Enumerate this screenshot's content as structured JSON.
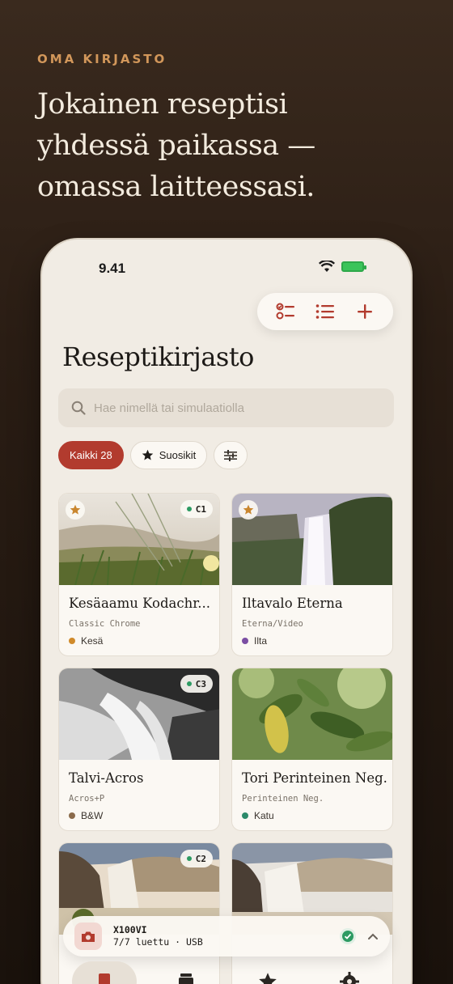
{
  "hero": {
    "eyebrow": "OMA KIRJASTO",
    "headline_line1": "Jokainen reseptisi",
    "headline_line2": "yhdessä paikassa —",
    "headline_line3": "omassa laitteessasi."
  },
  "status_bar": {
    "time": "9.41"
  },
  "toolbar": {
    "icons": [
      "select-list-icon",
      "list-icon",
      "plus-icon"
    ]
  },
  "page": {
    "title": "Reseptikirjasto",
    "search_placeholder": "Hae nimellä tai simulaatiolla"
  },
  "filters": {
    "all": "Kaikki 28",
    "favorites": "Suosikit"
  },
  "recipes": [
    {
      "title": "Kesäaamu Kodachr...",
      "sim": "Classic Chrome",
      "tag": "Kesä",
      "tag_color": "#d08a2a",
      "code": "C1",
      "favorite": true
    },
    {
      "title": "Iltavalo Eterna",
      "sim": "Eterna/Video",
      "tag": "Ilta",
      "tag_color": "#7b4ea3",
      "code": "",
      "favorite": true
    },
    {
      "title": "Talvi-Acros",
      "sim": "Acros+P",
      "tag": "B&W",
      "tag_color": "#8a6a4a",
      "code": "C3",
      "favorite": false
    },
    {
      "title": "Tori Perinteinen Neg.",
      "sim": "Perinteinen Neg.",
      "tag": "Katu",
      "tag_color": "#2c8a6a",
      "code": "",
      "favorite": false
    },
    {
      "title": "",
      "sim": "",
      "tag": "",
      "tag_color": "#2c9a62",
      "code": "C2",
      "favorite": false
    },
    {
      "title": "",
      "sim": "",
      "tag": "",
      "tag_color": "#2c9a62",
      "code": "",
      "favorite": false
    }
  ],
  "device": {
    "name": "X100VI",
    "status": "7/7 luettu · USB"
  },
  "colors": {
    "accent": "#b23b2e",
    "star": "#c9862e",
    "background": "#f1ece4"
  }
}
